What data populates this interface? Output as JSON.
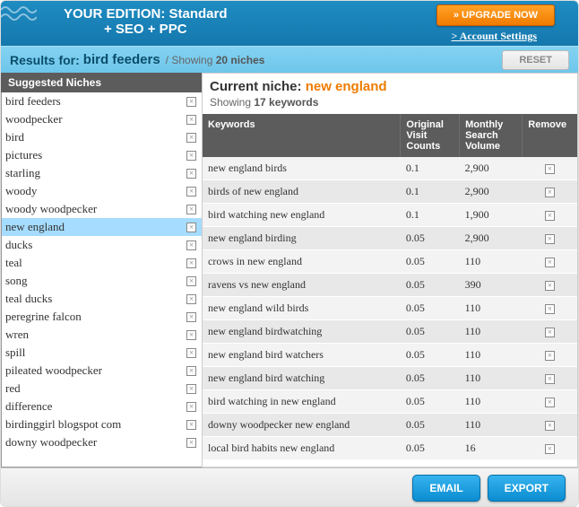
{
  "header": {
    "edition_label": "YOUR EDITION:",
    "edition_value_l1": "Standard",
    "edition_value_l2": "+ SEO + PPC",
    "upgrade_label": "» UPGRADE NOW",
    "account_link": "> Account Settings"
  },
  "subheader": {
    "results_label": "Results for:",
    "query": "bird feeders",
    "showing_prefix": "/ Showing",
    "niche_count": "20 niches",
    "reset_label": "RESET"
  },
  "sidebar": {
    "title": "Suggested Niches",
    "items": [
      {
        "label": "bird feeders"
      },
      {
        "label": "woodpecker"
      },
      {
        "label": "bird"
      },
      {
        "label": "pictures"
      },
      {
        "label": "starling"
      },
      {
        "label": "woody"
      },
      {
        "label": "woody woodpecker"
      },
      {
        "label": "new england",
        "selected": true
      },
      {
        "label": "ducks"
      },
      {
        "label": "teal"
      },
      {
        "label": "song"
      },
      {
        "label": "teal ducks"
      },
      {
        "label": "peregrine falcon"
      },
      {
        "label": "wren"
      },
      {
        "label": "spill"
      },
      {
        "label": "pileated woodpecker"
      },
      {
        "label": "red"
      },
      {
        "label": "difference"
      },
      {
        "label": "birdinggirl blogspot com"
      },
      {
        "label": "downy woodpecker"
      }
    ]
  },
  "main": {
    "title_prefix": "Current niche:",
    "niche_name": "new england",
    "showing_prefix": "Showing",
    "kw_count": "17 keywords",
    "columns": {
      "kw": "Keywords",
      "ovc": "Original Visit Counts",
      "msv": "Monthly Search Volume",
      "rm": "Remove"
    },
    "rows": [
      {
        "kw": "new england birds",
        "ovc": "0.1",
        "msv": "2,900"
      },
      {
        "kw": "birds of new england",
        "ovc": "0.1",
        "msv": "2,900"
      },
      {
        "kw": "bird watching new england",
        "ovc": "0.1",
        "msv": "1,900"
      },
      {
        "kw": "new england birding",
        "ovc": "0.05",
        "msv": "2,900"
      },
      {
        "kw": "crows in new england",
        "ovc": "0.05",
        "msv": "110"
      },
      {
        "kw": "ravens vs new england",
        "ovc": "0.05",
        "msv": "390"
      },
      {
        "kw": "new england wild birds",
        "ovc": "0.05",
        "msv": "110"
      },
      {
        "kw": "new england birdwatching",
        "ovc": "0.05",
        "msv": "110"
      },
      {
        "kw": "new england bird watchers",
        "ovc": "0.05",
        "msv": "110"
      },
      {
        "kw": "new england bird watching",
        "ovc": "0.05",
        "msv": "110"
      },
      {
        "kw": "bird watching in new england",
        "ovc": "0.05",
        "msv": "110"
      },
      {
        "kw": "downy woodpecker new england",
        "ovc": "0.05",
        "msv": "110"
      },
      {
        "kw": "local bird habits new england",
        "ovc": "0.05",
        "msv": "16"
      }
    ]
  },
  "footer": {
    "email_label": "EMAIL",
    "export_label": "EXPORT"
  }
}
